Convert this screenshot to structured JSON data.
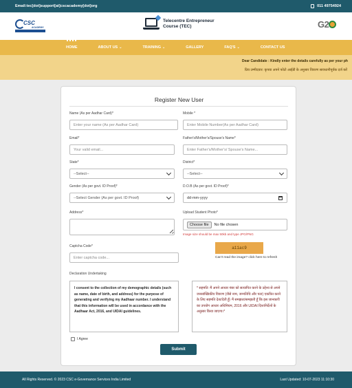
{
  "topbar": {
    "email": "Email:tec[dot]support[at]cscacademy[dot]org",
    "phone": "011 49754924"
  },
  "header": {
    "csc_logo_text": "CSC",
    "csc_logo_sub": "ACADEMY",
    "tec_title_line1": "Telecentre Entrepreneur",
    "tec_title_line2": "Course (TEC)",
    "g20_text": "G2"
  },
  "nav": {
    "items": [
      {
        "label": "HOME",
        "has_dropdown": false,
        "active": true
      },
      {
        "label": "ABOUT US",
        "has_dropdown": true
      },
      {
        "label": "TRAINING",
        "has_dropdown": true
      },
      {
        "label": "GALLERY",
        "has_dropdown": false
      },
      {
        "label": "FAQ'S",
        "has_dropdown": true
      },
      {
        "label": "CONTACT US",
        "has_dropdown": false
      }
    ]
  },
  "ticker": {
    "line1": "Dear Candidate : Kindly enter the details carefully as per your ph",
    "line2": "प्रिय उम्मीदवार: कृपया अपने फोटो आईडी के अनुसार विवरण सावधानीपूर्वक दर्ज करें"
  },
  "form": {
    "title": "Register New User",
    "name": {
      "label": "Name (As per Aadhar Card)*",
      "placeholder": "Enter your name  (As per Aadhar Card)"
    },
    "mobile": {
      "label": "Mobile *",
      "placeholder": "Enter Mobile Number(As per Aadhar Card)"
    },
    "email": {
      "label": "Email*",
      "placeholder": "Your valid email..."
    },
    "father": {
      "label": "Father's/Mother's/Spouse's Name*",
      "placeholder": "Enter Father's/Mother's/ Spouse's Name..."
    },
    "state": {
      "label": "State*",
      "value": "--Select--"
    },
    "district": {
      "label": "District*",
      "value": "--Select--"
    },
    "gender": {
      "label": "Gender (As per govt. ID Proof)*",
      "value": "--Select Gender (As per govt. ID Proof)"
    },
    "dob": {
      "label": "D.O.B (As per govt. ID Proof)*",
      "placeholder": "dd-mm-yyyy"
    },
    "address": {
      "label": "Address*"
    },
    "photo": {
      "label": "Upload Student Photo*",
      "button": "Choose file",
      "status": "No file chosen",
      "hint": "Image size should be max 50kb and type JPG/PNG"
    },
    "captcha": {
      "label": "Captcha Code*",
      "placeholder": "Enter captcha code...",
      "code": "a11ac9",
      "refresh_text": "Can't read the image? click here to refresh"
    },
    "declaration": {
      "label": "Declaration Undertaking",
      "english": "I consent to the collection of my demographic details (such as name, date of birth, and address) for the purpose of generating and verifying my Aadhaar number. I understand that this information will be used in accordance with the Aadhaar Act, 2016, and UIDAI guidelines.",
      "hindi": "* सहमति: मैं अपने आधार नंबर को सत्यापित करने के उद्देश्य से अपने जनसांख्यिकीय विवरण (जैसे नाम, जन्मतिथि और पता) एकत्रित करने के लिए सहमति देता/देती हूँ। मैं समझता/समझती हूँ कि इस जानकारी का उपयोग आधार अधिनियम, 2016 और UIDAI दिशानिर्देशों के अनुसार किया जाएगा।*"
    },
    "agree_label": "I Agree",
    "submit_label": "Submit"
  },
  "footer": {
    "left": "All Rights Reserved. © 2023 CSC e-Governance Services India Limited",
    "right": "Last Updated: 10-07-2023 11:10:30"
  },
  "colors": {
    "primary": "#1f5a6b",
    "nav": "#e9b84a",
    "ticker": "#f2d48a",
    "captcha": "#e9a84a",
    "hint_red": "#d23b3b"
  }
}
